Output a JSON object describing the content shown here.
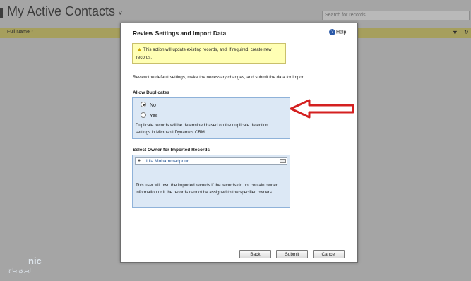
{
  "background": {
    "view_title": "My Active Contacts",
    "view_chevron": "˅",
    "search_placeholder": "Search for records",
    "column_header": "Full Name",
    "sort_glyph": "↑",
    "filter_glyph": "▼",
    "refresh_glyph": "↻"
  },
  "dialog": {
    "title": "Review Settings and Import Data",
    "help_label": "Help",
    "help_icon": "question-icon",
    "warning_icon": "warning-icon",
    "warning_text": "This action will update existing records, and, if required, create new records.",
    "intro_text": "Review the default settings, make the necessary changes, and submit the data for import.",
    "allow_duplicates": {
      "heading": "Allow Duplicates",
      "options": [
        {
          "label": "No",
          "checked": true
        },
        {
          "label": "Yes",
          "checked": false
        }
      ],
      "description": "Duplicate records will be determined based on the duplicate detection settings in Microsoft Dynamics CRM."
    },
    "owner": {
      "heading": "Select Owner for Imported Records",
      "user_name": "Lila Mohammadpour",
      "description": "This user will own the imported records if the records do not contain owner information or if the records cannot be assigned to the specified owners."
    },
    "buttons": {
      "back": "Back",
      "submit": "Submit",
      "cancel": "Cancel"
    }
  },
  "watermark": {
    "line1": "nic",
    "line2": "ایـزی بـاج"
  },
  "colors": {
    "arrow": "#d42020",
    "panel": "#dce8f5",
    "warning_bg": "#ffffb4",
    "grid_header": "#a69f5d"
  }
}
